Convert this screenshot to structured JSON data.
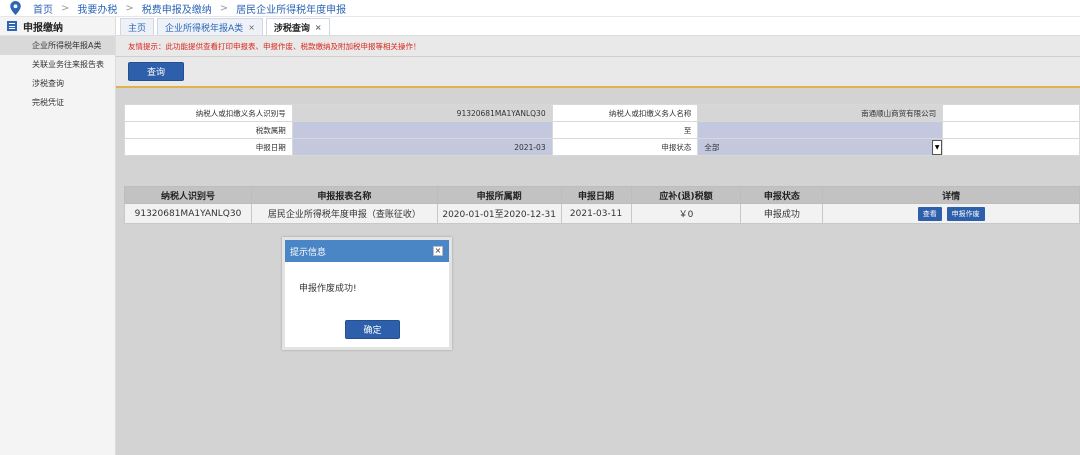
{
  "breadcrumb": {
    "items": [
      "首页",
      "我要办税",
      "税费申报及缴纳",
      "居民企业所得税年度申报"
    ],
    "separator": ">"
  },
  "sidebar": {
    "header": "申报缴纳",
    "items": [
      {
        "label": "企业所得税年报A类",
        "active": true
      },
      {
        "label": "关联业务往来报告表",
        "active": false
      },
      {
        "label": "涉税查询",
        "active": false
      },
      {
        "label": "完税凭证",
        "active": false
      }
    ]
  },
  "tabs": [
    {
      "label": "主页",
      "closable": false,
      "active": false
    },
    {
      "label": "企业所得税年报A类",
      "closable": true,
      "active": false
    },
    {
      "label": "涉税查询",
      "closable": true,
      "active": true
    }
  ],
  "tab_close_glyph": "×",
  "notice": "友情提示：此功能提供查看打印申报表、申报作废、税款缴纳及附加税申报等相关操作！",
  "query_button": "查询",
  "form": {
    "taxpayer_id_label": "纳税人或扣缴义务人识别号",
    "taxpayer_id_value": "91320681MA1YANLQ30",
    "taxpayer_name_label": "纳税人或扣缴义务人名称",
    "taxpayer_name_value": "南通顺山商贸有限公司",
    "period_label": "税款属期",
    "period_value": "",
    "to_label": "至",
    "to_value": "",
    "date_label": "申报日期",
    "date_value": "2021-03",
    "status_label": "申报状态",
    "status_value": "全部"
  },
  "result_table": {
    "headers": [
      "纳税人识别号",
      "申报报表名称",
      "申报所属期",
      "申报日期",
      "应补(退)税额",
      "申报状态",
      "详情"
    ],
    "rows": [
      {
        "id": "91320681MA1YANLQ30",
        "form_name": "居民企业所得税年度申报（查账征收）",
        "period": "2020-01-01至2020-12-31",
        "date": "2021-03-11",
        "amount": "￥0",
        "status": "申报成功",
        "view_btn": "查看",
        "void_btn": "申报作废"
      }
    ]
  },
  "dialog": {
    "title": "提示信息",
    "close_glyph": "×",
    "message": "申报作废成功!",
    "ok_button": "确定"
  },
  "colors": {
    "accent": "#2d5faa",
    "dialog_header": "#4a86c6",
    "notice_red": "#d9261c",
    "link_blue": "#2d66b5",
    "underline_gold": "#e2b24a"
  }
}
